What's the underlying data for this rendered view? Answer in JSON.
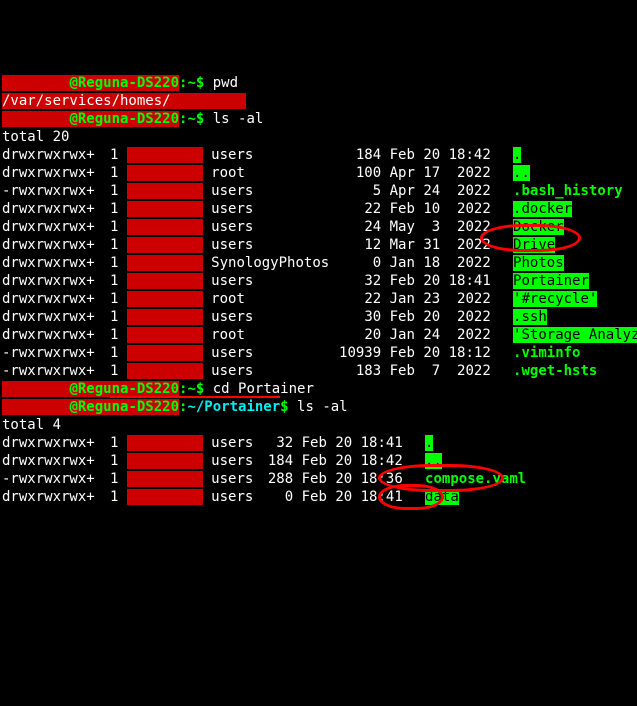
{
  "prompt": {
    "at": "@",
    "host": "Reguna-DS220",
    "colon": ":",
    "home_tilde": "~",
    "dollar": "$"
  },
  "cmd": {
    "pwd": "pwd",
    "ls_al": "ls -al",
    "cd_portainer": "cd Portainer"
  },
  "pwd_output_prefix": "/var/services/homes/",
  "total1": "total 20",
  "total2": "total 4",
  "path_portainer": "~/Portainer",
  "ls1": [
    {
      "perm": "drwxrwxrwx+",
      "l": "1",
      "grp": "users",
      "sz": "184",
      "dt": "Feb 20 18:42",
      "name": ".",
      "cls": "hg"
    },
    {
      "perm": "drwxrwxrwx+",
      "l": "1",
      "grp": "root",
      "sz": "100",
      "dt": "Apr 17  2022",
      "name": "..",
      "cls": "hg"
    },
    {
      "perm": "-rwxrwxrwx+",
      "l": "1",
      "grp": "users",
      "sz": "5",
      "dt": "Apr 24  2022",
      "name": ".bash_history",
      "cls": "g"
    },
    {
      "perm": "drwxrwxrwx+",
      "l": "1",
      "grp": "users",
      "sz": "22",
      "dt": "Feb 10  2022",
      "name": ".docker",
      "cls": "hg"
    },
    {
      "perm": "drwxrwxrwx+",
      "l": "1",
      "grp": "users",
      "sz": "24",
      "dt": "May  3  2022",
      "name": "Docker",
      "cls": "hg"
    },
    {
      "perm": "drwxrwxrwx+",
      "l": "1",
      "grp": "users",
      "sz": "12",
      "dt": "Mar 31  2022",
      "name": "Drive",
      "cls": "hg"
    },
    {
      "perm": "drwxrwxrwx+",
      "l": "1",
      "grp": "SynologyPhotos",
      "sz": "0",
      "dt": "Jan 18  2022",
      "name": "Photos",
      "cls": "hg"
    },
    {
      "perm": "drwxrwxrwx+",
      "l": "1",
      "grp": "users",
      "sz": "32",
      "dt": "Feb 20 18:41",
      "name": "Portainer",
      "cls": "hg"
    },
    {
      "perm": "drwxrwxrwx+",
      "l": "1",
      "grp": "root",
      "sz": "22",
      "dt": "Jan 23  2022",
      "name": "'#recycle'",
      "cls": "hg"
    },
    {
      "perm": "drwxrwxrwx+",
      "l": "1",
      "grp": "users",
      "sz": "30",
      "dt": "Feb 20  2022",
      "name": ".ssh",
      "cls": "hg"
    },
    {
      "perm": "drwxrwxrwx+",
      "l": "1",
      "grp": "root",
      "sz": "20",
      "dt": "Jan 24  2022",
      "name": "'Storage Analyzer'",
      "cls": "hg"
    },
    {
      "perm": "-rwxrwxrwx+",
      "l": "1",
      "grp": "users",
      "sz": "10939",
      "dt": "Feb 20 18:12",
      "name": ".viminfo",
      "cls": "g"
    },
    {
      "perm": "-rwxrwxrwx+",
      "l": "1",
      "grp": "users",
      "sz": "183",
      "dt": "Feb  7  2022",
      "name": ".wget-hsts",
      "cls": "g"
    }
  ],
  "ls2": [
    {
      "perm": "drwxrwxrwx+",
      "l": "1",
      "grp": "users",
      "sz": "32",
      "dt": "Feb 20 18:41",
      "name": ".",
      "cls": "hg"
    },
    {
      "perm": "drwxrwxrwx+",
      "l": "1",
      "grp": "users",
      "sz": "184",
      "dt": "Feb 20 18:42",
      "name": "..",
      "cls": "hg"
    },
    {
      "perm": "-rwxrwxrwx+",
      "l": "1",
      "grp": "users",
      "sz": "288",
      "dt": "Feb 20 18:36",
      "name": "compose.yaml",
      "cls": "g"
    },
    {
      "perm": "drwxrwxrwx+",
      "l": "1",
      "grp": "users",
      "sz": "0",
      "dt": "Feb 20 18:41",
      "name": "data",
      "cls": "hg"
    }
  ]
}
